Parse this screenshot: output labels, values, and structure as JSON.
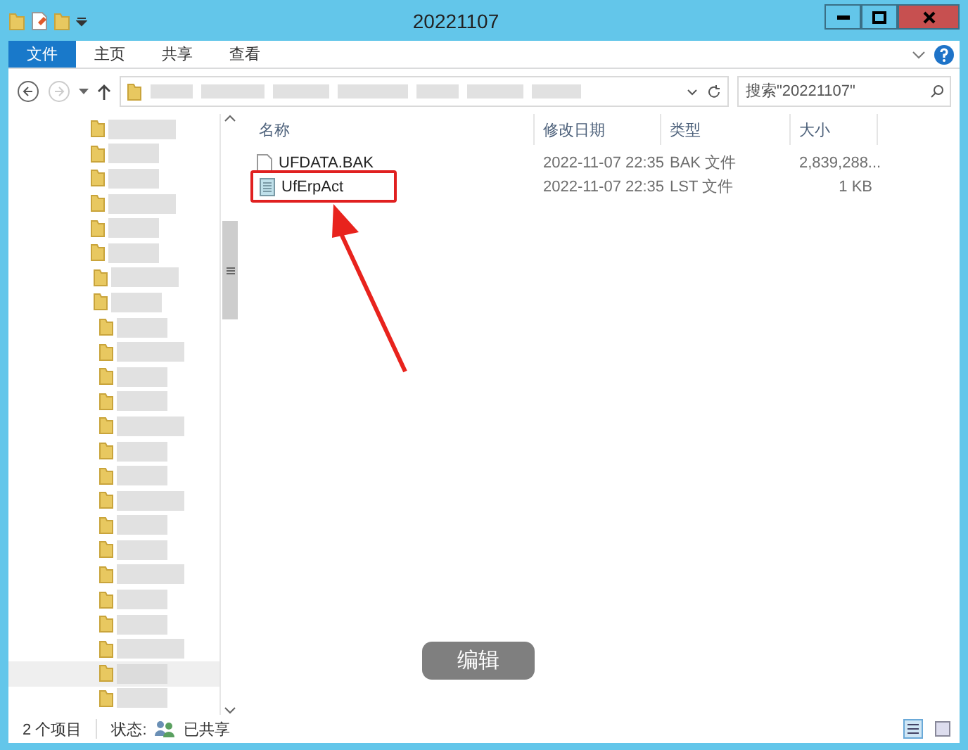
{
  "window": {
    "title": "20221107"
  },
  "ribbon_tabs": [
    {
      "label": "文件",
      "selected": true
    },
    {
      "label": "主页",
      "selected": false
    },
    {
      "label": "共享",
      "selected": false
    },
    {
      "label": "查看",
      "selected": false
    }
  ],
  "search": {
    "placeholder": "搜索\"20221107\""
  },
  "table": {
    "columns": [
      "名称",
      "修改日期",
      "类型",
      "大小"
    ],
    "rows": [
      {
        "name": "UFDATA.BAK",
        "kind": "blank",
        "date": "2022-11-07 22:35",
        "type": "BAK 文件",
        "size": "2,839,288...",
        "highlighted": false
      },
      {
        "name": "UfErpAct",
        "kind": "list",
        "date": "2022-11-07 22:35",
        "type": "LST 文件",
        "size": "1 KB",
        "highlighted": true
      }
    ]
  },
  "overlay_button": "编辑",
  "status_bar": {
    "count": "2 个项目",
    "state_label": "状态:",
    "state": "已共享"
  }
}
